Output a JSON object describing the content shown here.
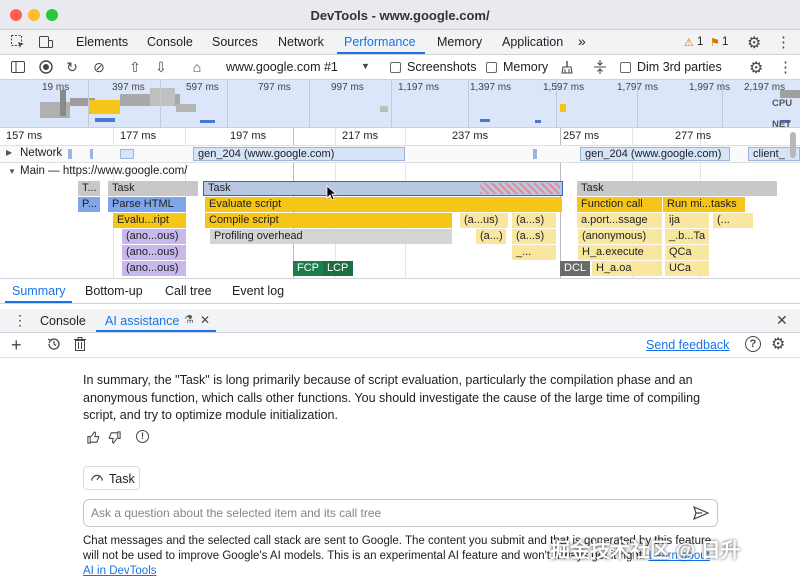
{
  "window": {
    "title": "DevTools - www.google.com/"
  },
  "main_tabs": [
    "Elements",
    "Console",
    "Sources",
    "Network",
    "Performance",
    "Memory",
    "Application"
  ],
  "main_tabs_active": "Performance",
  "more_tabs": "»",
  "badges": {
    "warnings": "1",
    "issues": "1"
  },
  "toolbar": {
    "url_select": "www.google.com #1",
    "screenshots_label": "Screenshots",
    "memory_label": "Memory",
    "dim_label": "Dim 3rd parties"
  },
  "overview": {
    "ticks": [
      "19 ms",
      "397 ms",
      "597 ms",
      "797 ms",
      "997 ms",
      "1,197 ms",
      "1,397 ms",
      "1,597 ms",
      "1,797 ms",
      "1,997 ms",
      "2,197 ms"
    ],
    "cpu_label": "CPU",
    "net_label": "NET"
  },
  "timeline": {
    "ticks": [
      "157 ms",
      "177 ms",
      "197 ms",
      "217 ms",
      "237 ms",
      "257 ms",
      "277 ms"
    ],
    "network_label": "Network",
    "network_bars": [
      "gen_204 (www.google.com)",
      "gen_204 (www.google.com)",
      "client_"
    ],
    "main_label": "Main — https://www.google.com/",
    "rows": {
      "r1": [
        "T...",
        "Task",
        "Task",
        "Task"
      ],
      "r2": [
        "P...",
        "Parse HTML",
        "Evaluate script",
        "Function call",
        "Run mi...tasks"
      ],
      "r3": [
        "Evalu...ript",
        "Compile script",
        "(a...us)",
        "(a...s)",
        "a.port...ssage",
        "ija",
        "(..."
      ],
      "r4": [
        "(ano...ous)",
        "Profiling overhead",
        "(a...)",
        "(a...s)",
        "(anonymous)",
        "_.b...Ta"
      ],
      "r5": [
        "(ano...ous)",
        "_...",
        "H_a.execute",
        "QCa"
      ],
      "r6": [
        "(ano...ous)",
        "FCP",
        "LCP",
        "DCL",
        "H_a.oa",
        "UCa"
      ]
    }
  },
  "bottom_tabs": [
    "Summary",
    "Bottom-up",
    "Call tree",
    "Event log"
  ],
  "bottom_tabs_active": "Summary",
  "drawer_tabs": {
    "console": "Console",
    "ai": "AI assistance"
  },
  "drawer": {
    "send_feedback": "Send feedback"
  },
  "summary_text": "In summary, the \"Task\" is long primarily because of script evaluation, particularly the compilation phase and an anonymous function, which calls other functions. You should investigate the cause of the large time of compiling script, and try to optimize module initialization.",
  "context_chip": "Task",
  "ask_placeholder": "Ask a question about the selected item and its call tree",
  "disclaimer": {
    "text": "Chat messages and the selected call stack are sent to Google. The content you submit and that is generated by this feature will not be used to improve Google's AI models. This is an experimental AI feature and won't always get it right.",
    "link": "Learn about AI in DevTools"
  },
  "watermark": "掘金技术社区 @ 日升",
  "colors": {
    "accent": "#1a73e8",
    "task_gray": "#c8c8c8",
    "script_yellow": "#f5c518",
    "parse_blue": "#7fa6e8",
    "fcp_green": "#1e7e4a"
  }
}
